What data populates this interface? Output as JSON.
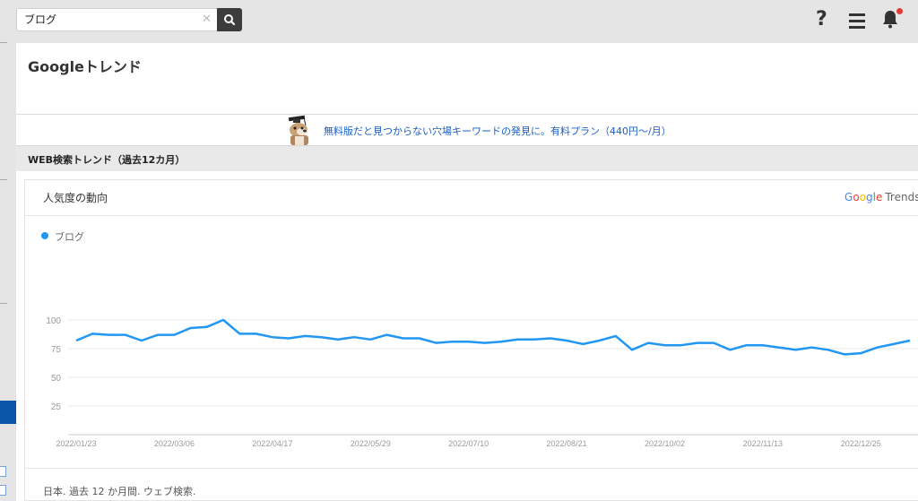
{
  "search": {
    "value": "ブログ",
    "clear_glyph": "✕"
  },
  "header_icons": [
    "help-icon",
    "menu-icon",
    "bell-icon"
  ],
  "page_title": "Googleトレンド",
  "promo": {
    "text": "無料版だと見つからない穴場キーワードの発見に。有料プラン（440円〜/月）",
    "color": "#1a5fc7"
  },
  "section_title": "WEB検索トレンド（過去12カ月）",
  "widget": {
    "title": "人気度の動向",
    "logo_google": "Google",
    "logo_trends": "Trends",
    "footnote": "日本. 過去 12 か月間. ウェブ検索."
  },
  "chart_data": {
    "type": "line",
    "series": [
      {
        "name": "ブログ",
        "color": "#2196f3",
        "values": [
          82,
          88,
          87,
          87,
          82,
          87,
          87,
          93,
          94,
          100,
          88,
          88,
          85,
          84,
          86,
          85,
          83,
          85,
          83,
          87,
          84,
          84,
          80,
          81,
          81,
          80,
          81,
          83,
          83,
          84,
          82,
          79,
          82,
          86,
          74,
          80,
          78,
          78,
          80,
          80,
          74,
          78,
          78,
          76,
          74,
          76,
          74,
          70,
          71,
          76,
          79,
          82
        ]
      }
    ],
    "x_tick_labels": [
      "2022/01/23",
      "2022/03/06",
      "2022/04/17",
      "2022/05/29",
      "2022/07/10",
      "2022/08/21",
      "2022/10/02",
      "2022/11/13",
      "2022/12/25"
    ],
    "x_tick_indices": [
      0,
      6,
      12,
      18,
      24,
      30,
      36,
      42,
      48
    ],
    "y_ticks": [
      100,
      75,
      50,
      25
    ],
    "ylim": [
      0,
      100
    ],
    "grid": true
  }
}
